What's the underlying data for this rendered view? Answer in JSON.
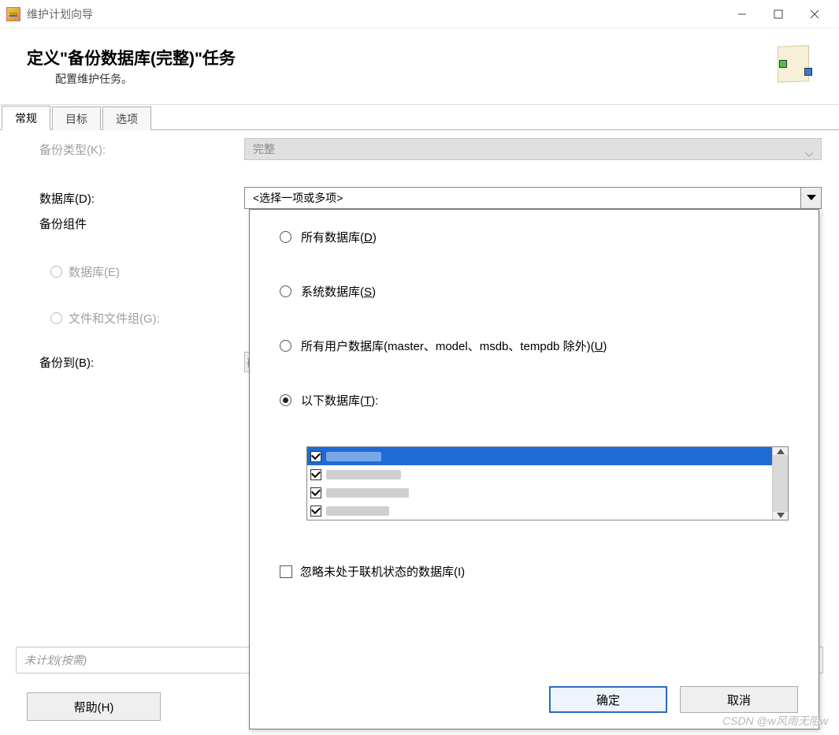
{
  "window": {
    "title": "维护计划向导"
  },
  "header": {
    "title": "定义\"备份数据库(完整)\"任务",
    "subtitle": "配置维护任务。"
  },
  "tabs": {
    "items": [
      {
        "label": "常规",
        "active": true
      },
      {
        "label": "目标",
        "active": false
      },
      {
        "label": "选项",
        "active": false
      }
    ]
  },
  "form": {
    "backupType": {
      "label": "备份类型(K):",
      "value": "完整"
    },
    "database": {
      "label": "数据库(D):",
      "value": "<选择一项或多项>"
    },
    "component": {
      "label": "备份组件"
    },
    "radioDb": {
      "label": "数据库(E)"
    },
    "radioFile": {
      "label": "文件和文件组(G):"
    },
    "backupTo": {
      "label": "备份到(B):",
      "stub": "磁"
    }
  },
  "dropdown": {
    "optAll": {
      "prefix": "所有数据库(",
      "u": "D",
      "suffix": ")"
    },
    "optSystem": {
      "prefix": "系统数据库(",
      "u": "S",
      "suffix": ")"
    },
    "optUser": {
      "prefix": "所有用户数据库(master、model、msdb、tempdb 除外)(",
      "u": "U",
      "suffix": ")"
    },
    "optThese": {
      "prefix": "以下数据库(",
      "u": "T",
      "suffix": "):"
    },
    "databases": [
      {
        "checked": true,
        "selected": true
      },
      {
        "checked": true,
        "selected": false
      },
      {
        "checked": true,
        "selected": false
      },
      {
        "checked": true,
        "selected": false
      }
    ],
    "ignoreOffline": {
      "prefix": "忽略未处于联机状态的数据库(",
      "u": "I",
      "suffix": ")"
    },
    "ok": "确定",
    "cancel": "取消"
  },
  "schedule": {
    "text": "未计划(按需)"
  },
  "help": {
    "label": "帮助(H)"
  },
  "watermark": "CSDN @w风雨无阻w"
}
